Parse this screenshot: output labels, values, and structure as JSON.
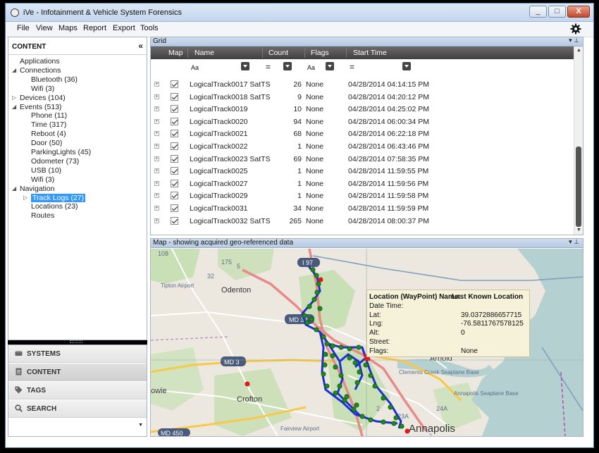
{
  "window": {
    "title": "iVe - Infotainment & Vehicle System Forensics",
    "minimize": "_",
    "maximize": "□",
    "close": "X"
  },
  "menu": [
    "File",
    "View",
    "Maps",
    "Report",
    "Export",
    "Tools"
  ],
  "left_panel": {
    "header": "CONTENT",
    "collapse": "«",
    "tree": [
      {
        "label": "Applications",
        "level": 0,
        "expandable": false
      },
      {
        "label": "Connections",
        "level": 0,
        "expandable": true,
        "expanded": true
      },
      {
        "label": "Bluetooth (36)",
        "level": 1
      },
      {
        "label": "Wifi (3)",
        "level": 1
      },
      {
        "label": "Devices (104)",
        "level": 0,
        "expandable": true,
        "expanded": false
      },
      {
        "label": "Events (513)",
        "level": 0,
        "expandable": true,
        "expanded": true
      },
      {
        "label": "Phone (11)",
        "level": 1
      },
      {
        "label": "Time (317)",
        "level": 1
      },
      {
        "label": "Reboot (4)",
        "level": 1
      },
      {
        "label": "Door (50)",
        "level": 1
      },
      {
        "label": "ParkingLights (45)",
        "level": 1
      },
      {
        "label": "Odometer (73)",
        "level": 1
      },
      {
        "label": "USB (10)",
        "level": 1
      },
      {
        "label": "Wifi (3)",
        "level": 1
      },
      {
        "label": "Navigation",
        "level": 0,
        "expandable": true,
        "expanded": true
      },
      {
        "label": "Track Logs (27)",
        "level": 1,
        "selected": true,
        "expandable": true
      },
      {
        "label": "Locations (23)",
        "level": 1
      },
      {
        "label": "Routes",
        "level": 1
      }
    ]
  },
  "nav_panel": [
    {
      "label": "SYSTEMS",
      "icon": "hard-drive-icon"
    },
    {
      "label": "CONTENT",
      "icon": "document-icon",
      "active": true
    },
    {
      "label": "TAGS",
      "icon": "tag-icon"
    },
    {
      "label": "SEARCH",
      "icon": "search-icon"
    }
  ],
  "grid": {
    "title": "Grid",
    "columns": [
      "Map",
      "Name",
      "Count",
      "Flags",
      "Start Time"
    ],
    "filters": {
      "name": "Aa",
      "count": "=",
      "flags": "Aa",
      "start": "="
    },
    "rows": [
      {
        "name": "LogicalTrack0017 SatTS",
        "count": "26",
        "flags": "None",
        "start": "04/28/2014 04:14:15 PM"
      },
      {
        "name": "LogicalTrack0018 SatTS",
        "count": "9",
        "flags": "None",
        "start": "04/28/2014 04:20:12 PM"
      },
      {
        "name": "LogicalTrack0019",
        "count": "10",
        "flags": "None",
        "start": "04/28/2014 04:25:02 PM"
      },
      {
        "name": "LogicalTrack0020",
        "count": "94",
        "flags": "None",
        "start": "04/28/2014 06:00:34 PM"
      },
      {
        "name": "LogicalTrack0021",
        "count": "68",
        "flags": "None",
        "start": "04/28/2014 06:22:18 PM"
      },
      {
        "name": "LogicalTrack0022",
        "count": "1",
        "flags": "None",
        "start": "04/28/2014 06:43:46 PM"
      },
      {
        "name": "LogicalTrack0023 SatTS",
        "count": "69",
        "flags": "None",
        "start": "04/28/2014 07:58:35 PM"
      },
      {
        "name": "LogicalTrack0025",
        "count": "1",
        "flags": "None",
        "start": "04/28/2014 11:59:55 PM"
      },
      {
        "name": "LogicalTrack0027",
        "count": "1",
        "flags": "None",
        "start": "04/28/2014 11:59:56 PM"
      },
      {
        "name": "LogicalTrack0029",
        "count": "1",
        "flags": "None",
        "start": "04/28/2014 11:59:58 PM"
      },
      {
        "name": "LogicalTrack0031",
        "count": "34",
        "flags": "None",
        "start": "04/28/2014 11:59:59 PM"
      },
      {
        "name": "LogicalTrack0032 SatTS",
        "count": "265",
        "flags": "None",
        "start": "04/28/2014 08:00:37 PM"
      }
    ]
  },
  "map": {
    "title": "Map - showing acquired geo-referenced data",
    "labels": {
      "odenton": "Odenton",
      "crofton": "Crofton",
      "bowie": "owie",
      "arnold": "Arnold",
      "annapolis": "Annapolis",
      "tipton": "Tipton Airport",
      "fairview": "Fairview Airport",
      "clements": "Clements Creek Seaplane Base",
      "annapolis_seaplane": "Annapolis Seaplane Base",
      "i97": "I 97",
      "md32": "MD 32",
      "md3": "MD 3",
      "md450": "MD 450",
      "r108": "108",
      "r175": "175",
      "r32": "32",
      "r5": "5",
      "r24a": "24A",
      "r23a": "23A",
      "r2": "2"
    },
    "popup": {
      "rows": [
        {
          "label": "Location (WayPoint) Name:",
          "value": "Last Known Location",
          "bold": true
        },
        {
          "label": "Date Time:",
          "value": ""
        },
        {
          "label": "Lat:",
          "value": "39.0372886657715"
        },
        {
          "label": "Lng:",
          "value": "-76.5811767578125"
        },
        {
          "label": "Alt:",
          "value": "0"
        },
        {
          "label": "Street:",
          "value": ""
        },
        {
          "label": "Flags:",
          "value": "None"
        }
      ]
    }
  }
}
